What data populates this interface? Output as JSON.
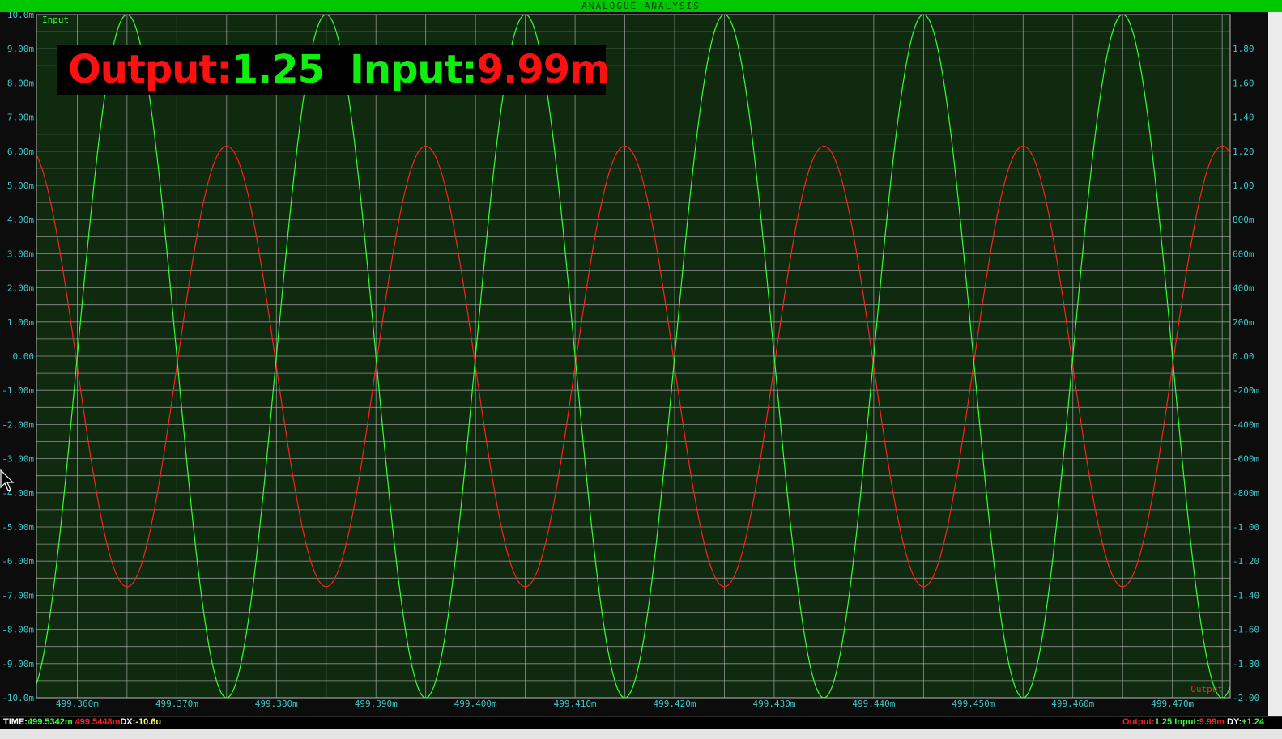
{
  "window": {
    "title": "ANALOGUE ANALYSIS"
  },
  "readout": {
    "output_label": "Output:",
    "output_value": "1.25",
    "input_label": "Input:",
    "input_value": "9.99m"
  },
  "status": {
    "time_label": "TIME:",
    "time_cursor1": "499.5342m",
    "time_cursor2": "499.5448m",
    "dx_label": "DX:",
    "dx_value": "-10.6u",
    "out_label": "Output:",
    "out_value": "1.25",
    "in_label": "Input:",
    "in_value": "9.99m",
    "dy_label": "DY:",
    "dy_value": "+1.24"
  },
  "colors": {
    "background": "#0f2a0f",
    "grid": "#b8b8b8",
    "input_trace": "#33ff33",
    "output_trace": "#ff2020",
    "axis_text": "#3cc8c8"
  },
  "chart_data": {
    "type": "line",
    "x": {
      "unit": "s",
      "range": [
        0.4993559,
        0.4994758
      ],
      "ticks": [
        "499.360m",
        "499.370m",
        "499.380m",
        "499.390m",
        "499.400m",
        "499.410m",
        "499.420m",
        "499.430m",
        "499.440m",
        "499.450m",
        "499.460m",
        "499.470m"
      ]
    },
    "y_left": {
      "range": [
        -0.01,
        0.01
      ],
      "ticks": [
        "10.0m",
        "9.00m",
        "8.00m",
        "7.00m",
        "6.00m",
        "5.00m",
        "4.00m",
        "3.00m",
        "2.00m",
        "1.00m",
        "0.00",
        "-1.00m",
        "-2.00m",
        "-3.00m",
        "-4.00m",
        "-5.00m",
        "-6.00m",
        "-7.00m",
        "-8.00m",
        "-9.00m",
        "-10.0m"
      ]
    },
    "y_right": {
      "range": [
        -2.0,
        2.0
      ],
      "ticks": [
        "1.80",
        "1.60",
        "1.40",
        "1.20",
        "1.00",
        "800m",
        "600m",
        "400m",
        "200m",
        "0.00",
        "-200m",
        "-400m",
        "-600m",
        "-800m",
        "-1.00",
        "-1.20",
        "-1.40",
        "-1.60",
        "-1.80",
        "-2.00"
      ]
    },
    "series": [
      {
        "name": "Input",
        "axis": "left",
        "amplitude": 0.01,
        "offset": 0,
        "frequency_hz": 50000,
        "peak_times": [
          0.499365,
          0.499385,
          0.499405,
          0.499425,
          0.499445,
          0.499465
        ]
      },
      {
        "name": "Output",
        "axis": "right",
        "amplitude": 1.29,
        "offset": -0.06,
        "frequency_hz": 50000,
        "peak_times": [
          0.499355,
          0.499375,
          0.499395,
          0.499415,
          0.499435,
          0.499455,
          0.499475
        ]
      }
    ],
    "trace_labels": {
      "top_left": "Input",
      "bottom_right": "Output"
    }
  }
}
